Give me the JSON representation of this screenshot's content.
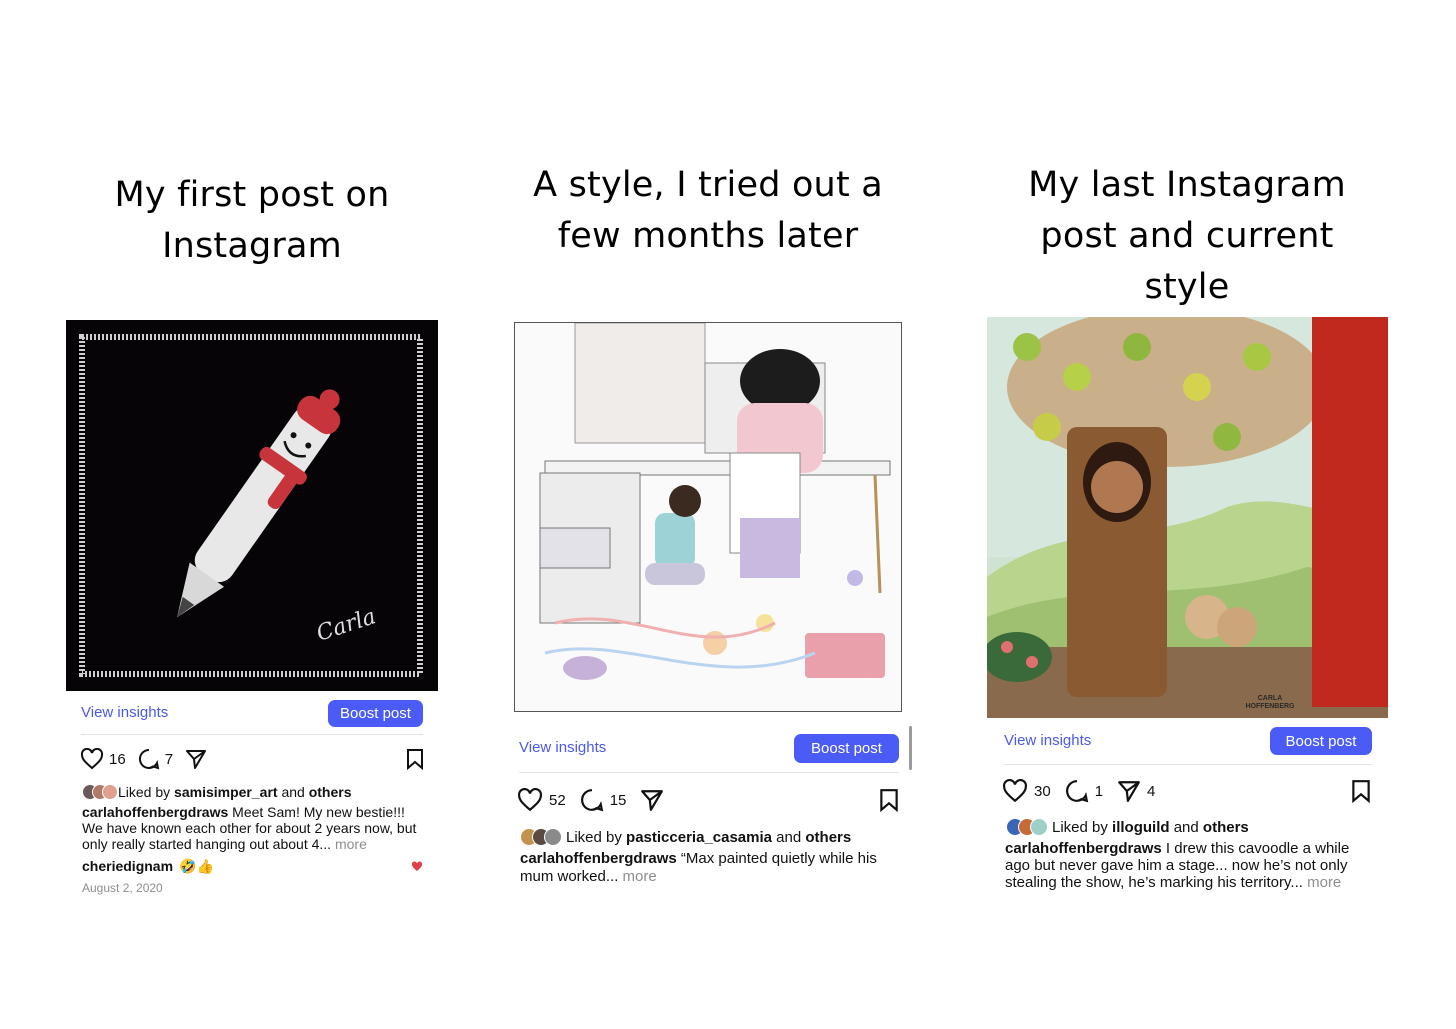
{
  "columns": [
    {
      "heading": "My first post on\nInstagram",
      "view_insights": "View insights",
      "boost": "Boost post",
      "likes": "16",
      "comments": "7",
      "liked_by_prefix": "Liked by ",
      "liked_by_user": "samisimper_art",
      "and": " and ",
      "others": "others",
      "caption_user": "carlahoffenbergdraws",
      "caption_text": " Meet Sam! My new bestie!!! We have known each other for about 2 years now, but only really started hanging out about 4...",
      "more": " more",
      "comment_user": "cheriedignam",
      "comment_emoji": "🤣👍",
      "date": "August 2, 2020",
      "signature": "Carla"
    },
    {
      "heading": "A style, I tried out a\nfew months later",
      "view_insights": "View insights",
      "boost": "Boost post",
      "likes": "52",
      "comments": "15",
      "liked_by_prefix": "Liked by ",
      "liked_by_user": "pasticceria_casamia",
      "and": " and ",
      "others": "others",
      "caption_user": "carlahoffenbergdraws",
      "caption_text": " “Max painted quietly while his mum worked...",
      "more": " more"
    },
    {
      "heading": "My last Instagram\npost and current\nstyle",
      "view_insights": "View insights",
      "boost": "Boost post",
      "likes": "30",
      "comments": "1",
      "shares": "4",
      "liked_by_prefix": "Liked by ",
      "liked_by_user": "illoguild",
      "and": " and ",
      "others": "others",
      "caption_user": "carlahoffenbergdraws",
      "caption_text": " I drew this cavoodle a while ago but never gave him a stage... now he’s not only stealing the show, he’s marking his territory...",
      "more": " more",
      "watermark": "CARLA HOFFENBERG"
    }
  ],
  "colors": {
    "accent": "#4a5cf5",
    "link": "#4a5ae8",
    "heart": "#e0404a"
  },
  "icons": [
    "heart-icon",
    "comment-icon",
    "share-icon",
    "bookmark-icon"
  ]
}
